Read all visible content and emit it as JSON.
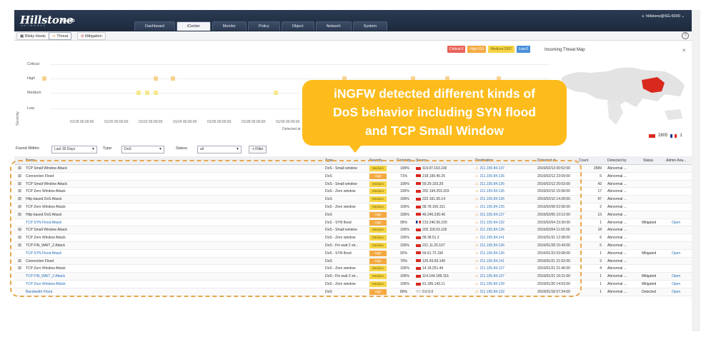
{
  "app": {
    "logo": "Hillstone",
    "logo_sub": "NETWORKS",
    "model": "T5060",
    "user": "hillstone@SG-6000",
    "nav_tabs": [
      "Dashboard",
      "iCenter",
      "Monitor",
      "Policy",
      "Object",
      "Network",
      "System"
    ],
    "active_nav": "iCenter",
    "sub_tabs": [
      "Risky Hosts",
      "Threat",
      "Mitigation"
    ],
    "active_sub": "Threat"
  },
  "chart_data": {
    "type": "scatter",
    "ylabel": "Severity",
    "xlabel": "Detected at",
    "y_categories": [
      "Critical",
      "High",
      "Medium",
      "Low"
    ],
    "x_ticks": [
      "01/18 00:00:00",
      "01/20 00:00:00",
      "01/22 00:00:00",
      "01/24 00:00:00",
      "01/26 00:00:00",
      "01/28 00:00:00",
      "01/30 00:00:00"
    ],
    "series": [
      {
        "name": "High",
        "points": [
          [
            "01/15 12:00",
            "High"
          ],
          [
            "01/22 00:00",
            "High"
          ],
          [
            "01/23 00:00",
            "High"
          ],
          [
            "02/02 00:00",
            "High"
          ],
          [
            "02/06 00:00",
            "High"
          ],
          [
            "02/08 00:00",
            "High"
          ],
          [
            "02/11 00:00",
            "High"
          ]
        ]
      },
      {
        "name": "Medium",
        "points": [
          [
            "01/21 00:00",
            "Medium"
          ],
          [
            "01/21 12:00",
            "Medium"
          ],
          [
            "01/22 00:00",
            "Medium"
          ],
          [
            "01/29 00:00",
            "Medium"
          ]
        ]
      }
    ],
    "legend": {
      "critical": "Critical:0",
      "high": "High:120",
      "medium": "Medium:2957",
      "low": "Low:0"
    }
  },
  "colors": {
    "critical": "#e8635b",
    "high": "#f4a940",
    "medium": "#f6d545",
    "low": "#4a90d9",
    "callout": "#fdbc1b"
  },
  "map": {
    "title": "Incoming Threat Map",
    "close": "×",
    "legend": [
      {
        "flag": "cn",
        "count": "2805"
      },
      {
        "flag": "fr",
        "count": "1"
      }
    ]
  },
  "callout": {
    "line1": "iNGFW detected different kinds of",
    "line2": "DoS behavior including SYN flood",
    "line3": "and TCP Small Window"
  },
  "filters": {
    "found_within_label": "Found Within:",
    "found_within_value": "Last 30 Days",
    "type_label": "Type:",
    "type_value": "DoS",
    "status_label": "Status:",
    "status_value": "all",
    "filter_button": "+ Filter"
  },
  "table": {
    "headers": [
      "Name",
      "Type",
      "Severity",
      "Certainty",
      "Source",
      "Destination",
      "Detected at",
      "Count",
      "Detected by",
      "Status",
      "Admin Ana..."
    ],
    "rows": [
      {
        "name": "TCP Small Window Attack",
        "type": "DoS - Small window",
        "sev": "Medium",
        "cert": "100%",
        "src": "119.97.163.100",
        "dst": "211.155.84.137",
        "time": "2016/02/13 00:52:00",
        "count": "2589",
        "by": "Abnormal ...",
        "status": "",
        "admin": "",
        "link": false
      },
      {
        "name": "Connection Flood",
        "type": "DoS",
        "sev": "High",
        "cert": "71%",
        "src": "218.199.40.25",
        "dst": "211.155.84.136",
        "time": "2016/02/12 23:59:00",
        "count": "5",
        "by": "Abnormal ...",
        "status": "",
        "admin": "",
        "link": false
      },
      {
        "name": "TCP Small Window Attack",
        "type": "DoS - Small window",
        "sev": "Medium",
        "cert": "100%",
        "src": "59.29.103.29",
        "dst": "211.155.84.136",
        "time": "2016/02/12 20:03:00",
        "count": "43",
        "by": "Abnormal ...",
        "status": "",
        "admin": "",
        "link": false
      },
      {
        "name": "TCP Zero Window Attack",
        "type": "DoS - Zero window",
        "sev": "Medium",
        "cert": "100%",
        "src": "202.194.203.203",
        "dst": "211.155.84.136",
        "time": "2016/02/10 15:58:00",
        "count": "17",
        "by": "Abnormal ...",
        "status": "",
        "admin": "",
        "link": false
      },
      {
        "name": "Http-based DoS Attack",
        "type": "DoS",
        "sev": "Medium",
        "cert": "100%",
        "src": "222.161.55.14",
        "dst": "211.155.84.136",
        "time": "2016/02/10 14:28:00",
        "count": "97",
        "by": "Abnormal ...",
        "status": "",
        "admin": "",
        "link": false
      },
      {
        "name": "TCP Zero Window Attack",
        "type": "DoS - Zero window",
        "sev": "Medium",
        "cert": "100%",
        "src": "58.78.165.151",
        "dst": "211.155.84.135",
        "time": "2016/02/08 02:58:00",
        "count": "2",
        "by": "Abnormal ...",
        "status": "",
        "admin": "",
        "link": false
      },
      {
        "name": "Http-based DoS Attack",
        "type": "DoS",
        "sev": "High",
        "cert": "100%",
        "src": "49.246.230.40",
        "dst": "211.155.84.137",
        "time": "2016/02/05 10:12:00",
        "count": "13",
        "by": "Abnormal ...",
        "status": "",
        "admin": "",
        "link": false
      },
      {
        "name": "TCP SYN Flood Attack",
        "type": "DoS - SYN flood",
        "sev": "High",
        "cert": "95%",
        "src": "213.246.56.220",
        "dst": "211.155.84.132",
        "time": "2016/02/04 23:30:00",
        "count": "1",
        "by": "Abnormal ...",
        "status": "Mitigated",
        "admin": "Open",
        "link": true,
        "flag": "fr"
      },
      {
        "name": "TCP Small Window Attack",
        "type": "DoS - Small window",
        "sev": "Medium",
        "cert": "100%",
        "src": "202.118.63.109",
        "dst": "211.155.84.136",
        "time": "2016/02/04 11:02:00",
        "count": "18",
        "by": "Abnormal ...",
        "status": "",
        "admin": "",
        "link": false
      },
      {
        "name": "TCP Zero Window Attack",
        "type": "DoS - Zero window",
        "sev": "Medium",
        "cert": "100%",
        "src": "58.38.51.2",
        "dst": "211.155.84.141",
        "time": "2016/01/31 12:38:00",
        "count": "6",
        "by": "Abnormal ...",
        "status": "",
        "admin": "",
        "link": false
      },
      {
        "name": "TCP FIN_WAIT_2 Attack",
        "type": "DoS - Fin wait 2 str...",
        "sev": "Medium",
        "cert": "100%",
        "src": "221.11.20.107",
        "dst": "211.155.84.136",
        "time": "2016/01/28 15:43:00",
        "count": "5",
        "by": "Abnormal ...",
        "status": "",
        "admin": "",
        "link": false
      },
      {
        "name": "TCP SYN Flood Attack",
        "type": "DoS - SYN flood",
        "sev": "High",
        "cert": "92%",
        "src": "59.61.72.156",
        "dst": "211.155.84.136",
        "time": "2016/01/23 03:08:00",
        "count": "1",
        "by": "Abnormal ...",
        "status": "Mitigated",
        "admin": "Open",
        "link": true
      },
      {
        "name": "Connection Flood",
        "type": "DoS",
        "sev": "High",
        "cert": "70%",
        "src": "125.43.60.140",
        "dst": "211.155.84.141",
        "time": "2016/01/21 21:52:00",
        "count": "3",
        "by": "Abnormal ...",
        "status": "",
        "admin": "",
        "link": false
      },
      {
        "name": "TCP Zero Window Attack",
        "type": "DoS - Zero window",
        "sev": "Medium",
        "cert": "100%",
        "src": "14.18.251.44",
        "dst": "211.155.84.137",
        "time": "2016/01/21 21:46:00",
        "count": "4",
        "by": "Abnormal ...",
        "status": "",
        "admin": "",
        "link": false
      },
      {
        "name": "TCP FIN_WAIT_2 Attack",
        "type": "DoS - Fin wait 2 str...",
        "sev": "Medium",
        "cert": "100%",
        "src": "114.104.189.116",
        "dst": "211.155.84.137",
        "time": "2016/01/21 16:21:00",
        "count": "1",
        "by": "Abnormal ...",
        "status": "Mitigated",
        "admin": "Open",
        "link": true
      },
      {
        "name": "TCP Zero Window Attack",
        "type": "DoS - Zero window",
        "sev": "Medium",
        "cert": "100%",
        "src": "61.185.143.11",
        "dst": "211.155.84.139",
        "time": "2016/01/20 14:53:00",
        "count": "1",
        "by": "Abnormal ...",
        "status": "Mitigated",
        "admin": "Open",
        "link": true
      },
      {
        "name": "Bandwidth Flood",
        "type": "DoS",
        "sev": "High",
        "cert": "80%",
        "src": "0.0.0.0",
        "dst": "211.155.84.132",
        "time": "2016/01/18 07:24:00",
        "count": "1",
        "by": "Abnormal ...",
        "status": "Detected",
        "admin": "Open",
        "link": true,
        "flag": "none"
      }
    ]
  }
}
